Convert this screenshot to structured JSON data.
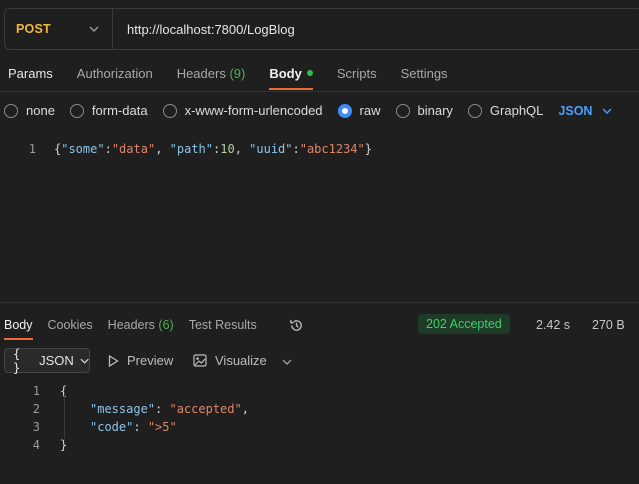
{
  "request": {
    "method": "POST",
    "url": "http://localhost:7800/LogBlog",
    "tabs": {
      "params": "Params",
      "authorization": "Authorization",
      "headers": "Headers",
      "headers_count": "(9)",
      "body": "Body",
      "scripts": "Scripts",
      "settings": "Settings"
    },
    "body_types": {
      "none": "none",
      "form_data": "form-data",
      "urlencoded": "x-www-form-urlencoded",
      "raw": "raw",
      "binary": "binary",
      "graphql": "GraphQL",
      "selected_format": "JSON"
    },
    "editor": {
      "line_1_number": "1",
      "line_1_tokens": {
        "t1": "{",
        "t2": "\"some\"",
        "t3": ":",
        "t4": "\"data\"",
        "t5": ", ",
        "t6": "\"path\"",
        "t7": ":",
        "t8": "10",
        "t9": ", ",
        "t10": "\"uuid\"",
        "t11": ":",
        "t12": "\"abc1234\"",
        "t13": "}"
      }
    }
  },
  "response": {
    "tabs": {
      "body": "Body",
      "cookies": "Cookies",
      "headers": "Headers",
      "headers_count": "(6)",
      "test_results": "Test Results"
    },
    "status": "202 Accepted",
    "time": "2.42 s",
    "size": "270 B",
    "view": {
      "braces": "{ }",
      "format": "JSON",
      "preview": "Preview",
      "visualize": "Visualize"
    },
    "lines": [
      {
        "num": "1",
        "text": "{"
      },
      {
        "num": "2",
        "key": "\"message\"",
        "sep": ": ",
        "value": "\"accepted\"",
        "tail": ","
      },
      {
        "num": "3",
        "key": "\"code\"",
        "sep": ": ",
        "value": "\">5\"",
        "tail": ""
      },
      {
        "num": "4",
        "text": "}"
      }
    ]
  },
  "colors": {
    "method": "#f0b840",
    "accent_tab": "#f06a35",
    "json_select": "#4a9fff",
    "status_text": "#3fd16b",
    "status_bg": "#1d3b26"
  }
}
